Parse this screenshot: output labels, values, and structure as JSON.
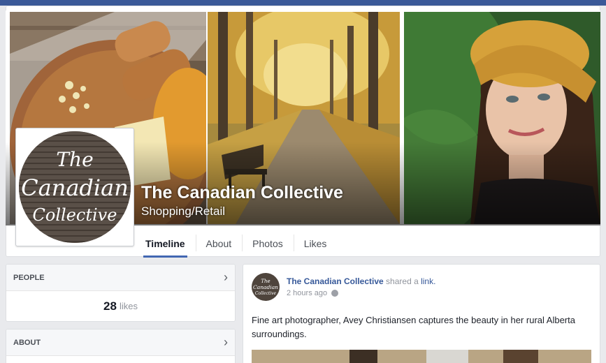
{
  "page": {
    "name": "The Canadian Collective",
    "category": "Shopping/Retail",
    "logo_text": [
      "The",
      "Canadian",
      "Collective"
    ]
  },
  "tabs": [
    {
      "label": "Timeline",
      "active": true
    },
    {
      "label": "About",
      "active": false
    },
    {
      "label": "Photos",
      "active": false
    },
    {
      "label": "Likes",
      "active": false
    }
  ],
  "sidebar": {
    "people": {
      "title": "PEOPLE",
      "likes_count": "28",
      "likes_label": "likes"
    },
    "about": {
      "title": "ABOUT"
    }
  },
  "post": {
    "author": "The Canadian Collective",
    "action": "shared a",
    "link_word": "link.",
    "time": "2 hours ago",
    "text": "Fine art photographer, Avey Christiansen captures the beauty in her rural Alberta surroundings."
  },
  "colors": {
    "brand": "#3b5998",
    "link": "#365899",
    "background": "#e9eaed"
  },
  "icons": {
    "chevron": "chevron-right-icon",
    "globe": "globe-icon"
  }
}
